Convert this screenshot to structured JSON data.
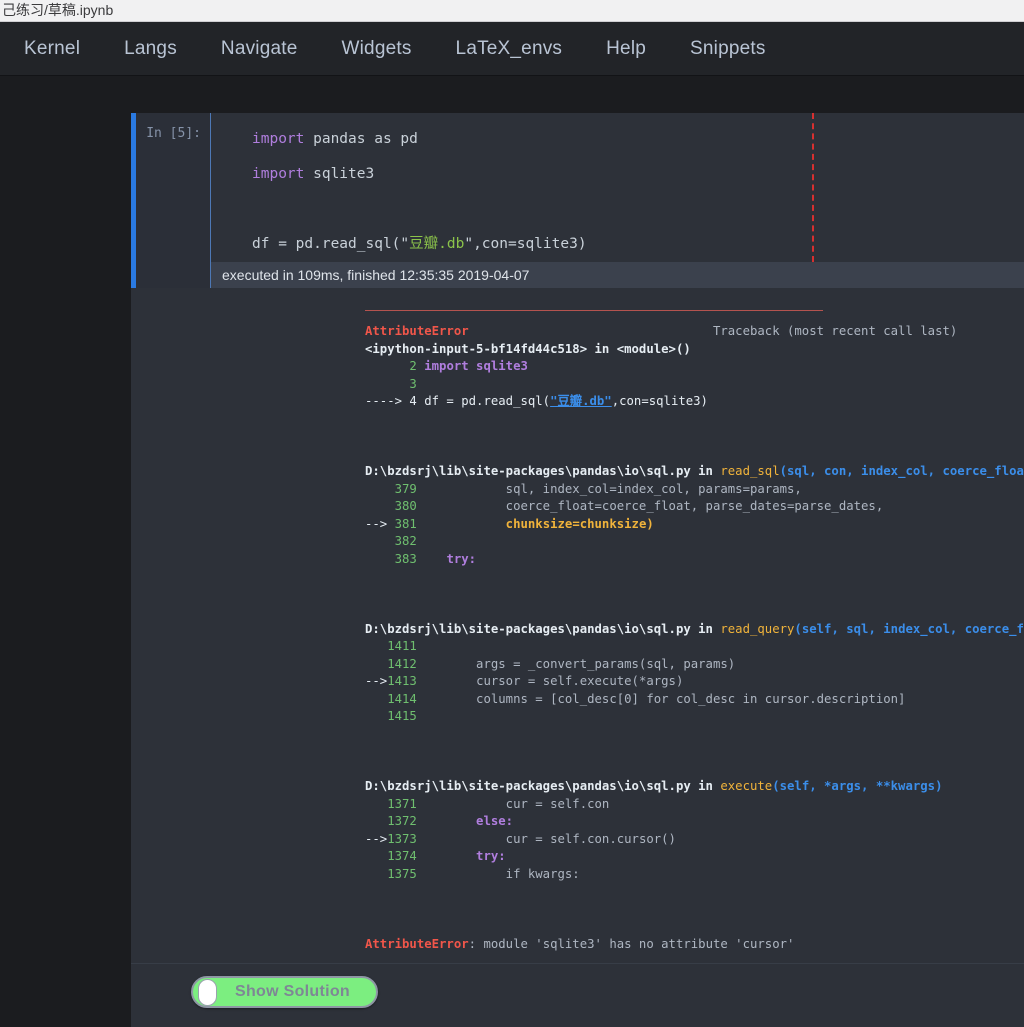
{
  "browser": {
    "tab_title": "己练习/草稿.ipynb"
  },
  "menubar": {
    "items": [
      {
        "label": "Kernel"
      },
      {
        "label": "Langs"
      },
      {
        "label": "Navigate"
      },
      {
        "label": "Widgets"
      },
      {
        "label": "LaTeX_envs"
      },
      {
        "label": "Help"
      },
      {
        "label": "Snippets"
      }
    ]
  },
  "cell": {
    "prompt": "In [5]:",
    "code": {
      "line1_kw": "import",
      "line1_rest": " pandas as pd",
      "line2_kw": "import",
      "line2_rest": " sqlite3",
      "line4_pre": "df = pd.read_sql(\"",
      "line4_str": "豆瓣.db",
      "line4_post": "\",con=sqlite3)"
    },
    "exec_info": "executed in 109ms, finished 12:35:35 2019-04-07"
  },
  "traceback": {
    "error_name": "AttributeError",
    "header_right": "Traceback (most recent call last)",
    "input_ref": "<ipython-input-5-bf14fd44c518> in <module>()",
    "ref_line_2_no": "      2",
    "ref_line_2_code": " import sqlite3",
    "ref_line_3_no": "      3",
    "ref_arrow_line": "----> 4 df = pd.read_sql(",
    "ref_arrow_str": "\"豆瓣.db\"",
    "ref_arrow_tail": ",con=sqlite3)",
    "frames": [
      {
        "path": "D:\\bzdsrj\\lib\\site-packages\\pandas\\io\\sql.py in ",
        "func": "read_sql",
        "args": "(sql, con, index_col, coerce_float, params, parse_dates, columns, chunksize",
        "lines": [
          {
            "no": "    379",
            "arrow": "",
            "code": "            sql, index_col=index_col, params=params,"
          },
          {
            "no": "    380",
            "arrow": "",
            "code": "            coerce_float=coerce_float, parse_dates=parse_dates,"
          },
          {
            "no": "    381",
            "arrow": "--> ",
            "code": "            chunksize=chunksize)",
            "highlight": true
          },
          {
            "no": "    382",
            "arrow": "",
            "code": ""
          },
          {
            "no": "    383",
            "arrow": "",
            "code": "    try:"
          }
        ]
      },
      {
        "path": "D:\\bzdsrj\\lib\\site-packages\\pandas\\io\\sql.py in ",
        "func": "read_query",
        "args": "(self, sql, index_col, coerce_float, params, parse_dates, chunksize)",
        "lines": [
          {
            "no": "   1411",
            "arrow": "",
            "code": ""
          },
          {
            "no": "   1412",
            "arrow": "",
            "code": "        args = _convert_params(sql, params)"
          },
          {
            "no": "   1413",
            "arrow": "--> ",
            "code": "        cursor = self.execute(*args)"
          },
          {
            "no": "   1414",
            "arrow": "",
            "code": "        columns = [col_desc[0] for col_desc in cursor.description]"
          },
          {
            "no": "   1415",
            "arrow": "",
            "code": ""
          }
        ]
      },
      {
        "path": "D:\\bzdsrj\\lib\\site-packages\\pandas\\io\\sql.py in ",
        "func": "execute",
        "args": "(self, *args, **kwargs)",
        "lines": [
          {
            "no": "   1371",
            "arrow": "",
            "code": "            cur = self.con"
          },
          {
            "no": "   1372",
            "arrow": "",
            "code": "        else:"
          },
          {
            "no": "   1373",
            "arrow": "--> ",
            "code": "            cur = self.con.cursor()"
          },
          {
            "no": "   1374",
            "arrow": "",
            "code": "        try:"
          },
          {
            "no": "   1375",
            "arrow": "",
            "code": "            if kwargs:"
          }
        ]
      }
    ],
    "final_error_name": "AttributeError",
    "final_error_message": ": module 'sqlite3' has no attribute 'cursor'"
  },
  "footer": {
    "toggle_label": "Show Solution"
  },
  "colors": {
    "accent_blue": "#2a7ae2",
    "toggle_green": "#7cee80",
    "error_red": "#f0564a",
    "ruler_red": "#d63030",
    "notebook_bg": "#2d3139",
    "menubar_bg": "#222428"
  }
}
